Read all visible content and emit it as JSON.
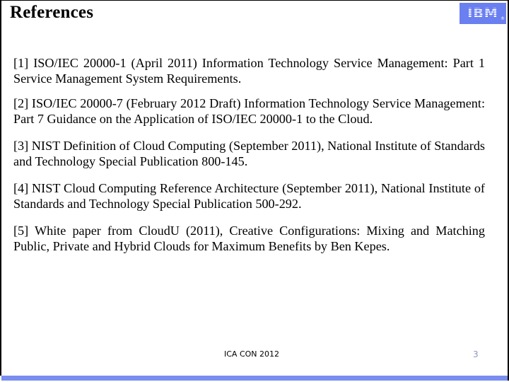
{
  "slide": {
    "title": "References",
    "logo": {
      "text": "IBM",
      "registered": "®",
      "color": "#6a7ff0"
    },
    "references": [
      "[1] ISO/IEC 20000-1 (April 2011) Information Technology Service Management: Part 1 Service Management System Requirements.",
      "[2] ISO/IEC 20000-7 (February 2012 Draft) Information Technology Service Management: Part 7 Guidance on the Application of ISO/IEC 20000-1 to the Cloud.",
      "[3] NIST Definition of Cloud Computing (September 2011), National Institute of Standards and Technology Special Publication 800-145.",
      "[4] NIST Cloud Computing Reference Architecture (September 2011), National Institute of Standards and Technology Special Publication 500-292.",
      "[5] White paper from CloudU (2011), Creative Configurations: Mixing and Matching Public, Private and Hybrid Clouds for Maximum Benefits by Ben Kepes."
    ],
    "footer": {
      "center_text": "ICA CON 2012",
      "page_number": "3"
    },
    "colors": {
      "accent_bar": "#7a8ef0",
      "page_number": "#8a96c8"
    }
  }
}
